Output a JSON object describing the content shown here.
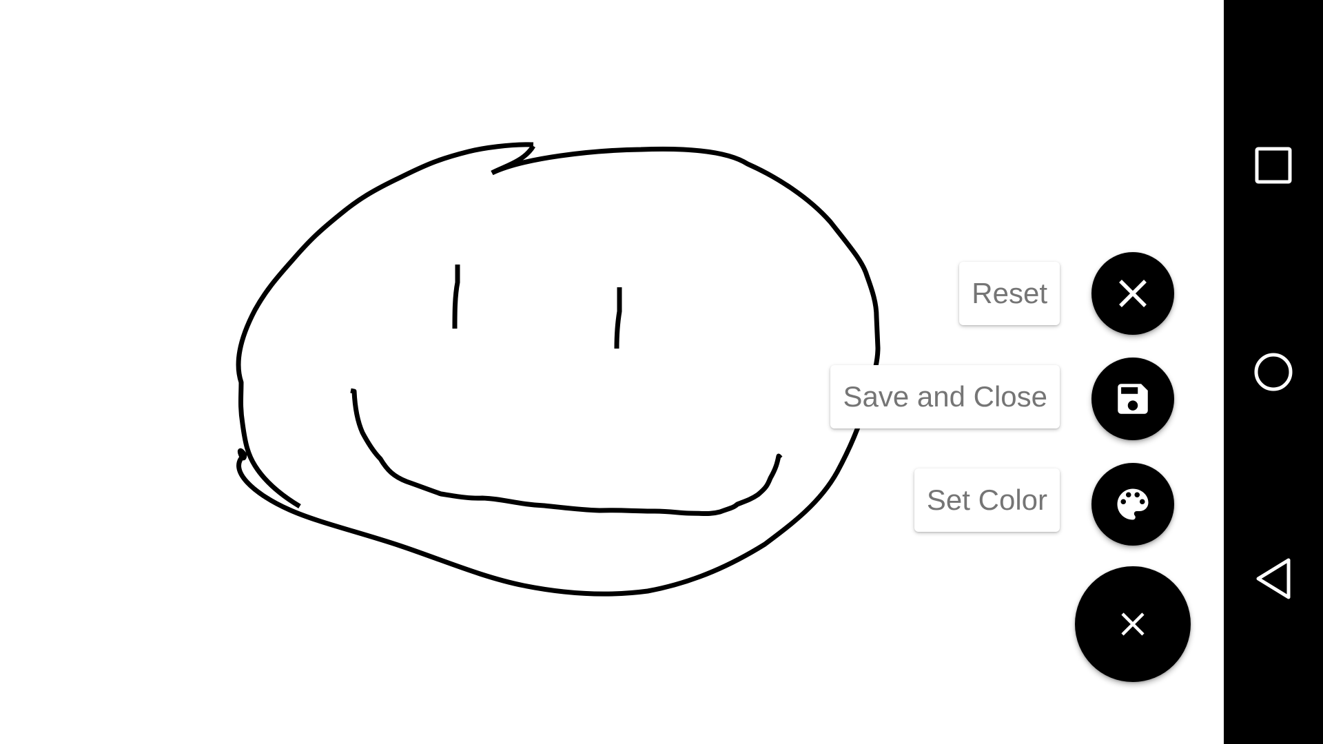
{
  "fab_menu": {
    "items": [
      {
        "label": "Reset",
        "icon": "close-icon"
      },
      {
        "label": "Save and Close",
        "icon": "floppy-save-icon"
      },
      {
        "label": "Set Color",
        "icon": "palette-icon"
      }
    ],
    "main_button": {
      "icon": "close-icon"
    }
  },
  "navigation_bar": {
    "buttons": [
      {
        "name": "recents",
        "icon": "square-recents-icon"
      },
      {
        "name": "home",
        "icon": "circle-home-icon"
      },
      {
        "name": "back",
        "icon": "triangle-back-icon"
      }
    ]
  },
  "colors": {
    "canvas_background": "#ffffff",
    "stroke": "#000000",
    "fab_background": "#000000",
    "label_text": "#757575",
    "navigation_bar": "#000000"
  }
}
